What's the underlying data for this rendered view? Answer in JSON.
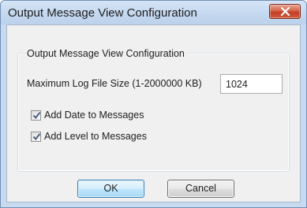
{
  "window": {
    "title": "Output Message View Configuration"
  },
  "group": {
    "title": "Output Message View Configuration"
  },
  "log_size": {
    "label": "Maximum Log File Size (1-2000000 KB)",
    "value": "1024"
  },
  "options": [
    {
      "label": "Add Date to Messages",
      "checked": true
    },
    {
      "label": "Add Level to Messages",
      "checked": true
    }
  ],
  "buttons": {
    "ok": "OK",
    "cancel": "Cancel"
  },
  "icons": {
    "close": "close-icon",
    "check": "checkmark-icon"
  },
  "colors": {
    "title_bar": "#c7daf0",
    "close_button": "#c94a31",
    "dialog_bg": "#f0f0f0",
    "ok_border": "#3c7fb1",
    "check_mark": "#4a5f80"
  }
}
